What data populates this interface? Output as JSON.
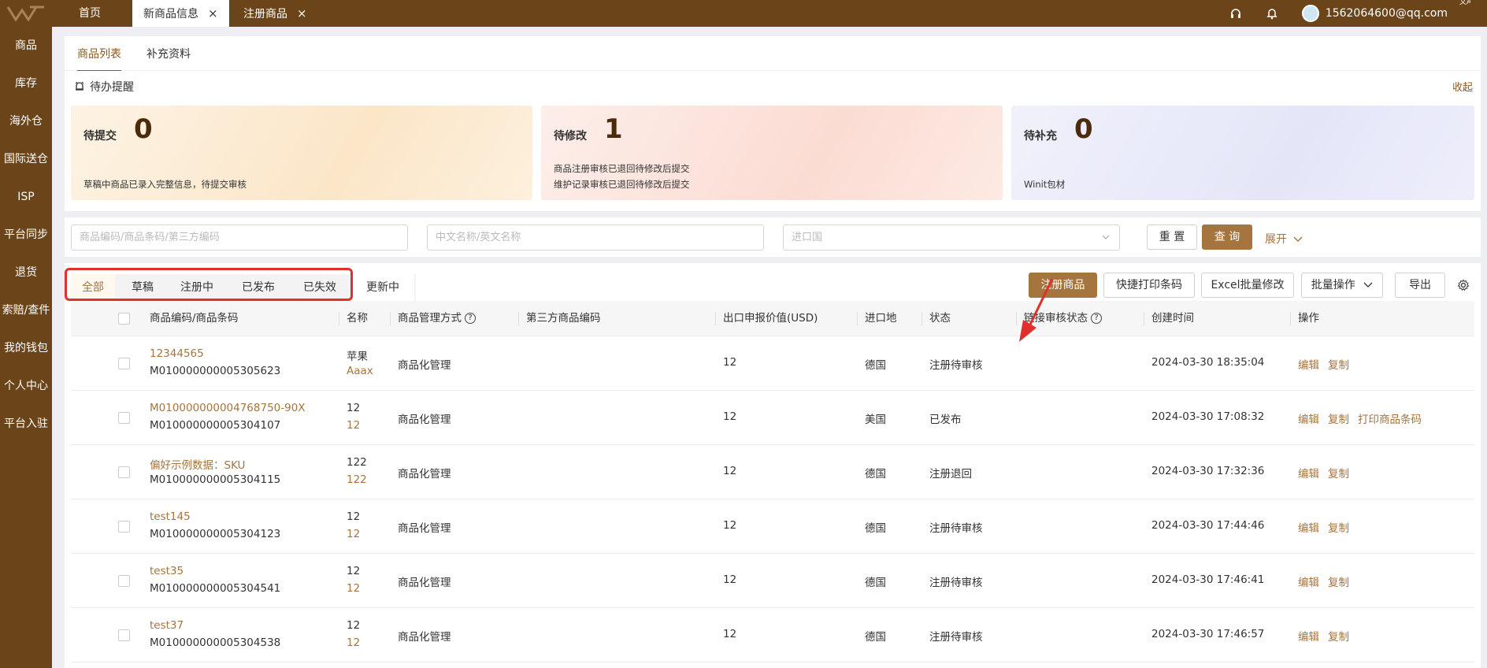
{
  "topbar": {
    "tabs": [
      {
        "label": "首页"
      },
      {
        "label": "新商品信息",
        "close": "×"
      },
      {
        "label": "注册商品",
        "close": "×"
      }
    ],
    "user": "1562064600@qq.com",
    "icons": [
      "headset-icon",
      "bell-icon",
      "avatar",
      "translate-icon"
    ]
  },
  "sidebar": {
    "items": [
      {
        "label": "商品"
      },
      {
        "label": "库存"
      },
      {
        "label": "海外仓"
      },
      {
        "label": "国际送仓"
      },
      {
        "label": "ISP"
      },
      {
        "label": "平台同步"
      },
      {
        "label": "退货"
      },
      {
        "label": "索赔/查件"
      },
      {
        "label": "我的钱包"
      },
      {
        "label": "个人中心"
      },
      {
        "label": "平台入驻"
      }
    ]
  },
  "subtabs": [
    {
      "label": "商品列表"
    },
    {
      "label": "补充资料"
    }
  ],
  "todo": {
    "title": "待办提醒",
    "collapse": "收起",
    "cards": [
      {
        "title": "待提交",
        "count": "0",
        "desc1": "草稿中商品已录入完整信息，待提交审核",
        "desc2": ""
      },
      {
        "title": "待修改",
        "count": "1",
        "desc1": "商品注册审核已退回待修改后提交",
        "desc2": "维护记录审核已退回待修改后提交"
      },
      {
        "title": "待补充",
        "count": "0",
        "desc1": "Winit包材",
        "desc2": ""
      }
    ]
  },
  "filters": {
    "code_placeholder": "商品编码/商品条码/第三方编码",
    "name_placeholder": "中文名称/英文名称",
    "country_placeholder": "进口国",
    "reset": "重 置",
    "query": "查 询",
    "expand": "展开"
  },
  "status_tabs": [
    {
      "label": "全部"
    },
    {
      "label": "草稿"
    },
    {
      "label": "注册中"
    },
    {
      "label": "已发布"
    },
    {
      "label": "已失效"
    },
    {
      "label": "更新中"
    }
  ],
  "actions": {
    "register": "注册商品",
    "print_barcode": "快捷打印条码",
    "excel_edit": "Excel批量修改",
    "batch": "批量操作",
    "export": "导出"
  },
  "table": {
    "headers": {
      "code": "商品编码/商品条码",
      "name": "名称",
      "mgmt": "商品管理方式",
      "third": "第三方商品编码",
      "value": "出口申报价值(USD)",
      "country": "进口地",
      "status": "状态",
      "link_status": "链接审核状态",
      "created": "创建时间",
      "ops": "操作"
    },
    "rows": [
      {
        "code": "12344565",
        "barcode": "M010000000005305623",
        "name1": "苹果",
        "name2": "Aaax",
        "mgmt": "商品化管理",
        "value": "12",
        "country": "德国",
        "status": "注册待审核",
        "created": "2024-03-30 18:35:04",
        "op1": "编辑",
        "op2": "复制",
        "op3": ""
      },
      {
        "code": "M010000000004768750-90X",
        "barcode": "M010000000005304107",
        "name1": "12",
        "name2": "12",
        "mgmt": "商品化管理",
        "value": "12",
        "country": "美国",
        "status": "已发布",
        "created": "2024-03-30 17:08:32",
        "op1": "编辑",
        "op2": "复制",
        "op3": "打印商品条码"
      },
      {
        "code": "偏好示例数据：SKU",
        "barcode": "M010000000005304115",
        "name1": "122",
        "name2": "122",
        "mgmt": "商品化管理",
        "value": "12",
        "country": "德国",
        "status": "注册退回",
        "created": "2024-03-30 17:32:36",
        "op1": "编辑",
        "op2": "复制",
        "op3": ""
      },
      {
        "code": "test145",
        "barcode": "M010000000005304123",
        "name1": "12",
        "name2": "12",
        "mgmt": "商品化管理",
        "value": "12",
        "country": "德国",
        "status": "注册待审核",
        "created": "2024-03-30 17:44:46",
        "op1": "编辑",
        "op2": "复制",
        "op3": ""
      },
      {
        "code": "test35",
        "barcode": "M010000000005304541",
        "name1": "12",
        "name2": "12",
        "mgmt": "商品化管理",
        "value": "12",
        "country": "德国",
        "status": "注册待审核",
        "created": "2024-03-30 17:46:41",
        "op1": "编辑",
        "op2": "复制",
        "op3": ""
      },
      {
        "code": "test37",
        "barcode": "M010000000005304538",
        "name1": "12",
        "name2": "12",
        "mgmt": "商品化管理",
        "value": "12",
        "country": "德国",
        "status": "注册待审核",
        "created": "2024-03-30 17:46:57",
        "op1": "编辑",
        "op2": "复制",
        "op3": ""
      }
    ]
  },
  "colors": {
    "brand": "#6b4419",
    "accent": "#a5743f",
    "highlight": "#e0302c"
  }
}
